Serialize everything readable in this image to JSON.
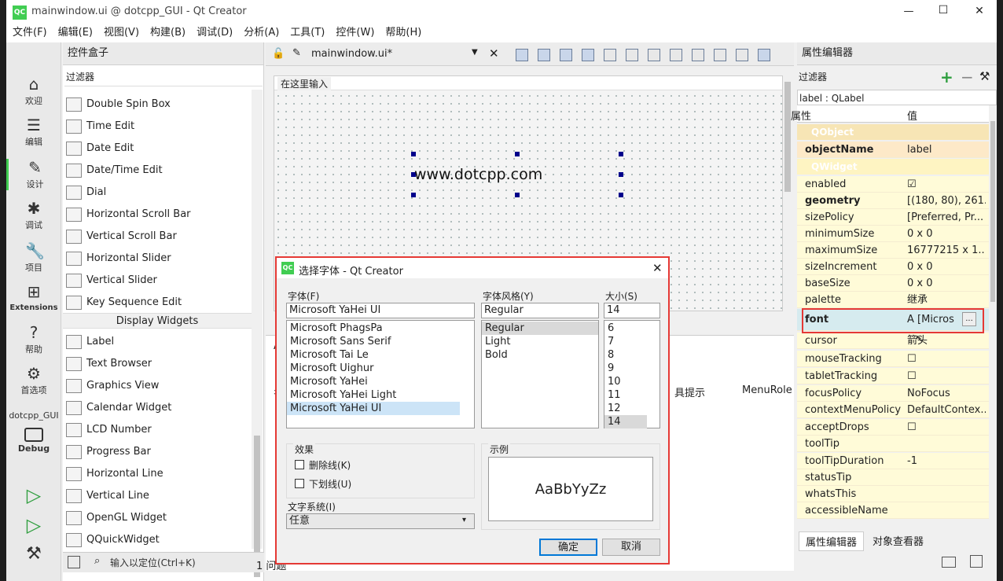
{
  "window": {
    "title": "mainwindow.ui @ dotcpp_GUI - Qt Creator",
    "logo": "QC",
    "controls": [
      "—",
      "☐",
      "✕"
    ]
  },
  "menu": [
    "文件(F)",
    "编辑(E)",
    "视图(V)",
    "构建(B)",
    "调试(D)",
    "分析(A)",
    "工具(T)",
    "控件(W)",
    "帮助(H)"
  ],
  "modes": [
    {
      "label": "欢迎",
      "icon": "⌂"
    },
    {
      "label": "编辑",
      "icon": "☰"
    },
    {
      "label": "设计",
      "icon": "✎"
    },
    {
      "label": "调试",
      "icon": "✱"
    },
    {
      "label": "项目",
      "icon": "🔧"
    },
    {
      "label": "Extensions",
      "icon": "⊞"
    },
    {
      "label": "帮助",
      "icon": "?"
    },
    {
      "label": "首选项",
      "icon": "⚙"
    }
  ],
  "kit": {
    "project": "dotcpp_GUI",
    "target": "Debug"
  },
  "widgetbox": {
    "title": "控件盒子",
    "filter": "过滤器",
    "items": [
      "Double Spin Box",
      "Time Edit",
      "Date Edit",
      "Date/Time Edit",
      "Dial",
      "Horizontal Scroll Bar",
      "Vertical Scroll Bar",
      "Horizontal Slider",
      "Vertical Slider",
      "Key Sequence Edit"
    ],
    "section": "Display Widgets",
    "display_items": [
      "Label",
      "Text Browser",
      "Graphics View",
      "Calendar Widget",
      "LCD Number",
      "Progress Bar",
      "Horizontal Line",
      "Vertical Line",
      "OpenGL Widget",
      "QQuickWidget"
    ],
    "locate_placeholder": "输入以定位(Ctrl+K)",
    "bottom_status": "1 问题"
  },
  "editor": {
    "file": "mainwindow.ui*",
    "menu_hint": "在这里输入",
    "label_text": "www.dotcpp.com",
    "col_tip": "具提示",
    "col_role": "MenuRole",
    "col_name": "名",
    "tab_stub": "Ac"
  },
  "props": {
    "title": "属性编辑器",
    "filter": "过滤器",
    "object": "label : QLabel",
    "col_prop": "属性",
    "col_value": "值",
    "sections": {
      "qobject": "QObject",
      "qwidget": "QWidget"
    },
    "rows": [
      {
        "n": "objectName",
        "v": "label",
        "bold": true
      },
      {
        "n": "enabled",
        "v": "☑"
      },
      {
        "n": "geometry",
        "v": "[(180, 80), 261...",
        "bold": true
      },
      {
        "n": "sizePolicy",
        "v": "[Preferred, Pr..."
      },
      {
        "n": "minimumSize",
        "v": "0 x 0"
      },
      {
        "n": "maximumSize",
        "v": "16777215 x 1..."
      },
      {
        "n": "sizeIncrement",
        "v": "0 x 0"
      },
      {
        "n": "baseSize",
        "v": "0 x 0"
      },
      {
        "n": "palette",
        "v": "继承"
      },
      {
        "n": "font",
        "v": "A [Micros",
        "bold": true
      },
      {
        "n": "cursor",
        "v": "箭头"
      },
      {
        "n": "mouseTracking",
        "v": "☐"
      },
      {
        "n": "tabletTracking",
        "v": "☐"
      },
      {
        "n": "focusPolicy",
        "v": "NoFocus"
      },
      {
        "n": "contextMenuPolicy",
        "v": "DefaultContex..."
      },
      {
        "n": "acceptDrops",
        "v": "☐"
      },
      {
        "n": "toolTip",
        "v": ""
      },
      {
        "n": "toolTipDuration",
        "v": "-1"
      },
      {
        "n": "statusTip",
        "v": ""
      },
      {
        "n": "whatsThis",
        "v": ""
      },
      {
        "n": "accessibleName",
        "v": ""
      }
    ],
    "tabs": [
      "属性编辑器",
      "对象查看器"
    ]
  },
  "dialog": {
    "title": "选择字体 - Qt Creator",
    "font_label": "字体(F)",
    "style_label": "字体风格(Y)",
    "size_label": "大小(S)",
    "font_value": "Microsoft YaHei UI",
    "style_value": "Regular",
    "size_value": "14",
    "fonts": [
      "Microsoft PhagsPa",
      "Microsoft Sans Serif",
      "Microsoft Tai Le",
      "Microsoft Uighur",
      "Microsoft YaHei",
      "Microsoft YaHei Light",
      "Microsoft YaHei UI"
    ],
    "styles": [
      "Regular",
      "Light",
      "Bold"
    ],
    "sizes": [
      "6",
      "7",
      "8",
      "9",
      "10",
      "11",
      "12",
      "14"
    ],
    "effects": "效果",
    "strike": "删除线(K)",
    "underline": "下划线(U)",
    "sample_label": "示例",
    "sample": "AaBbYyZz",
    "writing": "文字系统(I)",
    "writing_value": "任意",
    "ok": "确定",
    "cancel": "取消"
  },
  "colors": {
    "accent": "#e53935",
    "selection": "#cce4f7",
    "propbg": "#fffbd8"
  }
}
